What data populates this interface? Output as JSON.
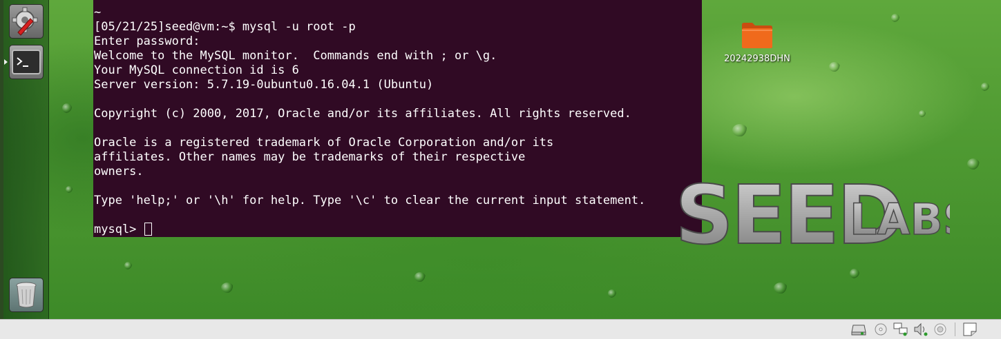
{
  "launcher": {
    "items": [
      {
        "name": "system-settings-icon"
      },
      {
        "name": "terminal-icon"
      },
      {
        "name": "trash-icon"
      }
    ]
  },
  "terminal": {
    "lines": [
      "~",
      "[05/21/25]seed@vm:~$ mysql -u root -p",
      "Enter password:",
      "Welcome to the MySQL monitor.  Commands end with ; or \\g.",
      "Your MySQL connection id is 6",
      "Server version: 5.7.19-0ubuntu0.16.04.1 (Ubuntu)",
      "",
      "Copyright (c) 2000, 2017, Oracle and/or its affiliates. All rights reserved.",
      "",
      "Oracle is a registered trademark of Oracle Corporation and/or its",
      "affiliates. Other names may be trademarks of their respective",
      "owners.",
      "",
      "Type 'help;' or '\\h' for help. Type '\\c' to clear the current input statement.",
      ""
    ],
    "prompt": "mysql> "
  },
  "desktop": {
    "folder_label": "20242938DHN",
    "logo_text_main": "SEED",
    "logo_text_sub": "LABS"
  },
  "statusbar": {
    "icons": [
      "hard-disk-icon",
      "optical-drive-icon",
      "network-icon",
      "audio-icon",
      "webcam-icon",
      "notes-icon"
    ]
  },
  "colors": {
    "terminal_bg": "#300a24",
    "terminal_fg": "#ffffff",
    "desktop_green": "#4f9a32",
    "folder_orange": "#f06a1c"
  }
}
